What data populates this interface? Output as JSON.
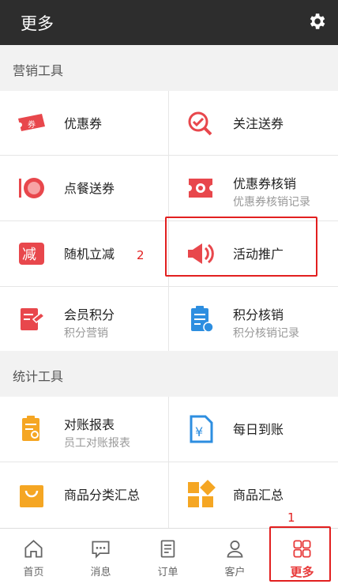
{
  "header": {
    "title": "更多",
    "settings_icon": "gear-icon"
  },
  "sections": {
    "marketing": "营销工具",
    "stats": "统计工具"
  },
  "marketing_items": [
    {
      "title": "优惠券",
      "subtitle": "",
      "icon": "coupon-ticket-icon"
    },
    {
      "title": "关注送券",
      "subtitle": "",
      "icon": "search-check-icon"
    },
    {
      "title": "点餐送券",
      "subtitle": "",
      "icon": "dining-plate-icon"
    },
    {
      "title": "优惠券核销",
      "subtitle": "优惠券核销记录",
      "icon": "coupon-verify-icon"
    },
    {
      "title": "随机立减",
      "subtitle": "",
      "icon": "random-discount-icon"
    },
    {
      "title": "活动推广",
      "subtitle": "",
      "icon": "megaphone-icon"
    },
    {
      "title": "会员积分",
      "subtitle": "积分营销",
      "icon": "member-points-icon"
    },
    {
      "title": "积分核销",
      "subtitle": "积分核销记录",
      "icon": "clipboard-points-icon"
    }
  ],
  "stats_items": [
    {
      "title": "对账报表",
      "subtitle": "员工对账报表",
      "icon": "report-icon"
    },
    {
      "title": "每日到账",
      "subtitle": "",
      "icon": "daily-yuan-icon"
    },
    {
      "title": "商品分类汇总",
      "subtitle": "",
      "icon": "shopping-bag-icon"
    },
    {
      "title": "商品汇总",
      "subtitle": "",
      "icon": "product-grid-icon"
    }
  ],
  "tabs": [
    {
      "label": "首页",
      "icon": "home-icon"
    },
    {
      "label": "消息",
      "icon": "message-icon"
    },
    {
      "label": "订单",
      "icon": "order-icon"
    },
    {
      "label": "客户",
      "icon": "customer-icon"
    },
    {
      "label": "更多",
      "icon": "more-grid-icon"
    }
  ],
  "annotations": {
    "marker_1": "1",
    "marker_2": "2"
  },
  "colors": {
    "header_bg": "#2d2d2d",
    "accent_red": "#e83a3a",
    "orange": "#f5a623",
    "blue": "#2d8ee0"
  }
}
